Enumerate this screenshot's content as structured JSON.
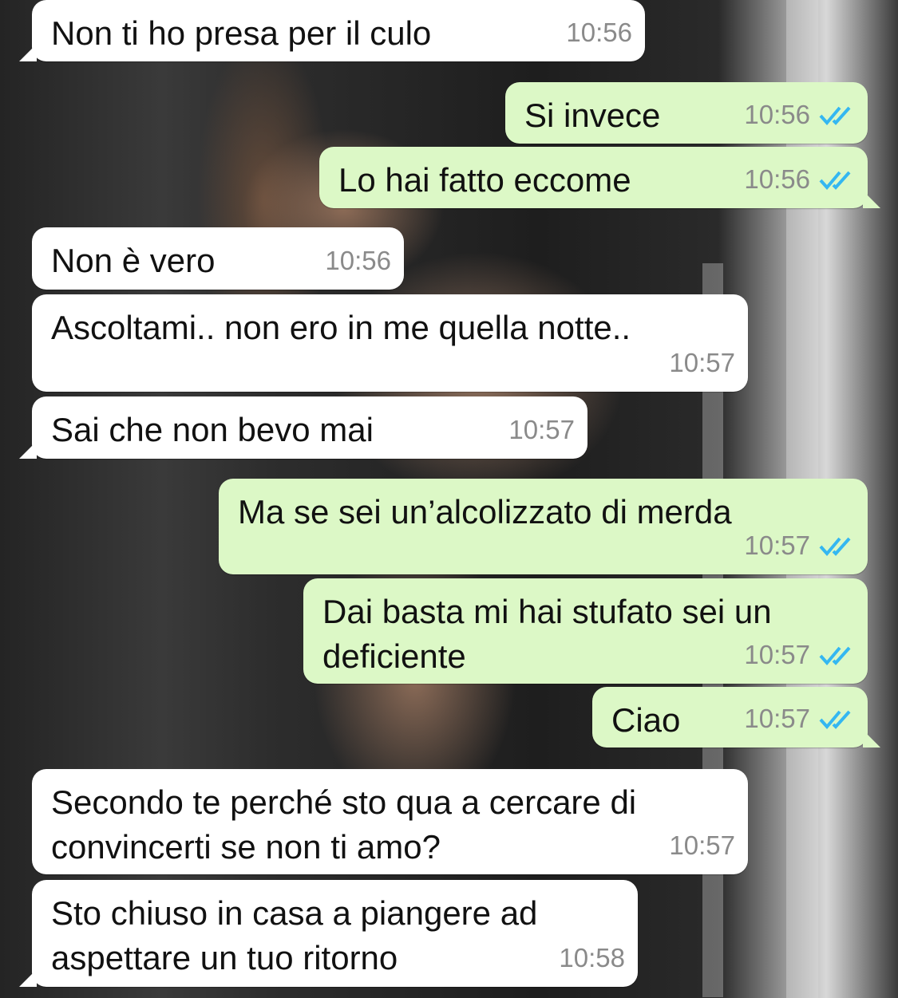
{
  "chat": {
    "messages": [
      {
        "dir": "in",
        "text": "Non ti ho presa per il culo",
        "time": "10:56"
      },
      {
        "dir": "out",
        "text": "Si invece",
        "time": "10:56",
        "ticks": "read"
      },
      {
        "dir": "out",
        "text": "Lo hai fatto eccome",
        "time": "10:56",
        "ticks": "read"
      },
      {
        "dir": "in",
        "text": "Non è vero",
        "time": "10:56"
      },
      {
        "dir": "in",
        "text": "Ascoltami.. non ero in me quella notte..",
        "time": "10:57"
      },
      {
        "dir": "in",
        "text": "Sai che non bevo mai",
        "time": "10:57"
      },
      {
        "dir": "out",
        "text": "Ma se sei un’alcolizzato di merda",
        "time": "10:57",
        "ticks": "read"
      },
      {
        "dir": "out",
        "text": "Dai basta mi hai stufato sei un\ndeficiente",
        "time": "10:57",
        "ticks": "read"
      },
      {
        "dir": "out",
        "text": "Ciao",
        "time": "10:57",
        "ticks": "read"
      },
      {
        "dir": "in",
        "text": "Secondo te perché sto qua a cercare di\nconvincerti se non ti amo?",
        "time": "10:57"
      },
      {
        "dir": "in",
        "text": "Sto chiuso in casa a piangere ad\naspettare un tuo ritorno",
        "time": "10:58"
      }
    ]
  },
  "colors": {
    "incoming_bubble": "#ffffff",
    "outgoing_bubble": "#dcf8c6",
    "read_ticks": "#34b7f1",
    "timestamp": "#8a8a8a"
  },
  "icons": {
    "read_receipt": "double-check-icon"
  }
}
